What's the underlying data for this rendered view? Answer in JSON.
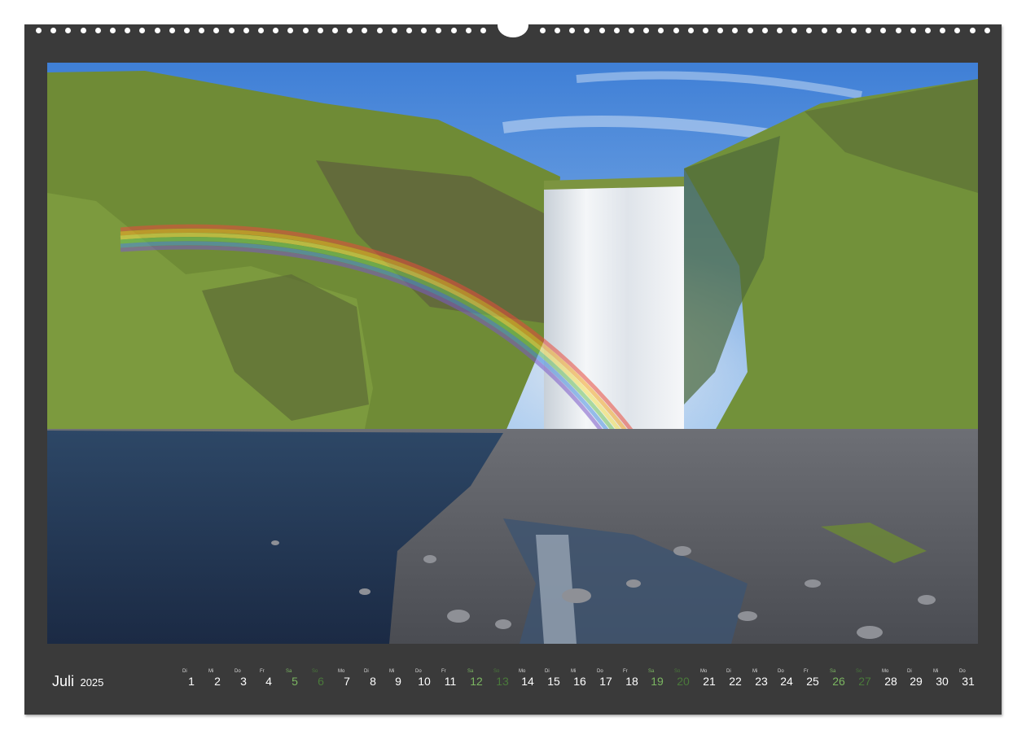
{
  "calendar": {
    "month": "Juli",
    "year": "2025",
    "days": [
      {
        "weekday": "Di",
        "day": "1",
        "type": "weekday"
      },
      {
        "weekday": "Mi",
        "day": "2",
        "type": "weekday"
      },
      {
        "weekday": "Do",
        "day": "3",
        "type": "weekday"
      },
      {
        "weekday": "Fr",
        "day": "4",
        "type": "weekday"
      },
      {
        "weekday": "Sa",
        "day": "5",
        "type": "sat"
      },
      {
        "weekday": "So",
        "day": "6",
        "type": "sun"
      },
      {
        "weekday": "Mo",
        "day": "7",
        "type": "weekday"
      },
      {
        "weekday": "Di",
        "day": "8",
        "type": "weekday"
      },
      {
        "weekday": "Mi",
        "day": "9",
        "type": "weekday"
      },
      {
        "weekday": "Do",
        "day": "10",
        "type": "weekday"
      },
      {
        "weekday": "Fr",
        "day": "11",
        "type": "weekday"
      },
      {
        "weekday": "Sa",
        "day": "12",
        "type": "sat"
      },
      {
        "weekday": "So",
        "day": "13",
        "type": "sun"
      },
      {
        "weekday": "Mo",
        "day": "14",
        "type": "weekday"
      },
      {
        "weekday": "Di",
        "day": "15",
        "type": "weekday"
      },
      {
        "weekday": "Mi",
        "day": "16",
        "type": "weekday"
      },
      {
        "weekday": "Do",
        "day": "17",
        "type": "weekday"
      },
      {
        "weekday": "Fr",
        "day": "18",
        "type": "weekday"
      },
      {
        "weekday": "Sa",
        "day": "19",
        "type": "sat"
      },
      {
        "weekday": "So",
        "day": "20",
        "type": "sun"
      },
      {
        "weekday": "Mo",
        "day": "21",
        "type": "weekday"
      },
      {
        "weekday": "Di",
        "day": "22",
        "type": "weekday"
      },
      {
        "weekday": "Mi",
        "day": "23",
        "type": "weekday"
      },
      {
        "weekday": "Do",
        "day": "24",
        "type": "weekday"
      },
      {
        "weekday": "Fr",
        "day": "25",
        "type": "weekday"
      },
      {
        "weekday": "Sa",
        "day": "26",
        "type": "sat"
      },
      {
        "weekday": "So",
        "day": "27",
        "type": "sun"
      },
      {
        "weekday": "Mo",
        "day": "28",
        "type": "weekday"
      },
      {
        "weekday": "Di",
        "day": "29",
        "type": "weekday"
      },
      {
        "weekday": "Mi",
        "day": "30",
        "type": "weekday"
      },
      {
        "weekday": "Do",
        "day": "31",
        "type": "weekday"
      }
    ]
  },
  "colors": {
    "sheet_background": "#3a3a3a",
    "saturday": "#7bb661",
    "sunday": "#4a7a3a",
    "day_text": "#ffffff"
  }
}
